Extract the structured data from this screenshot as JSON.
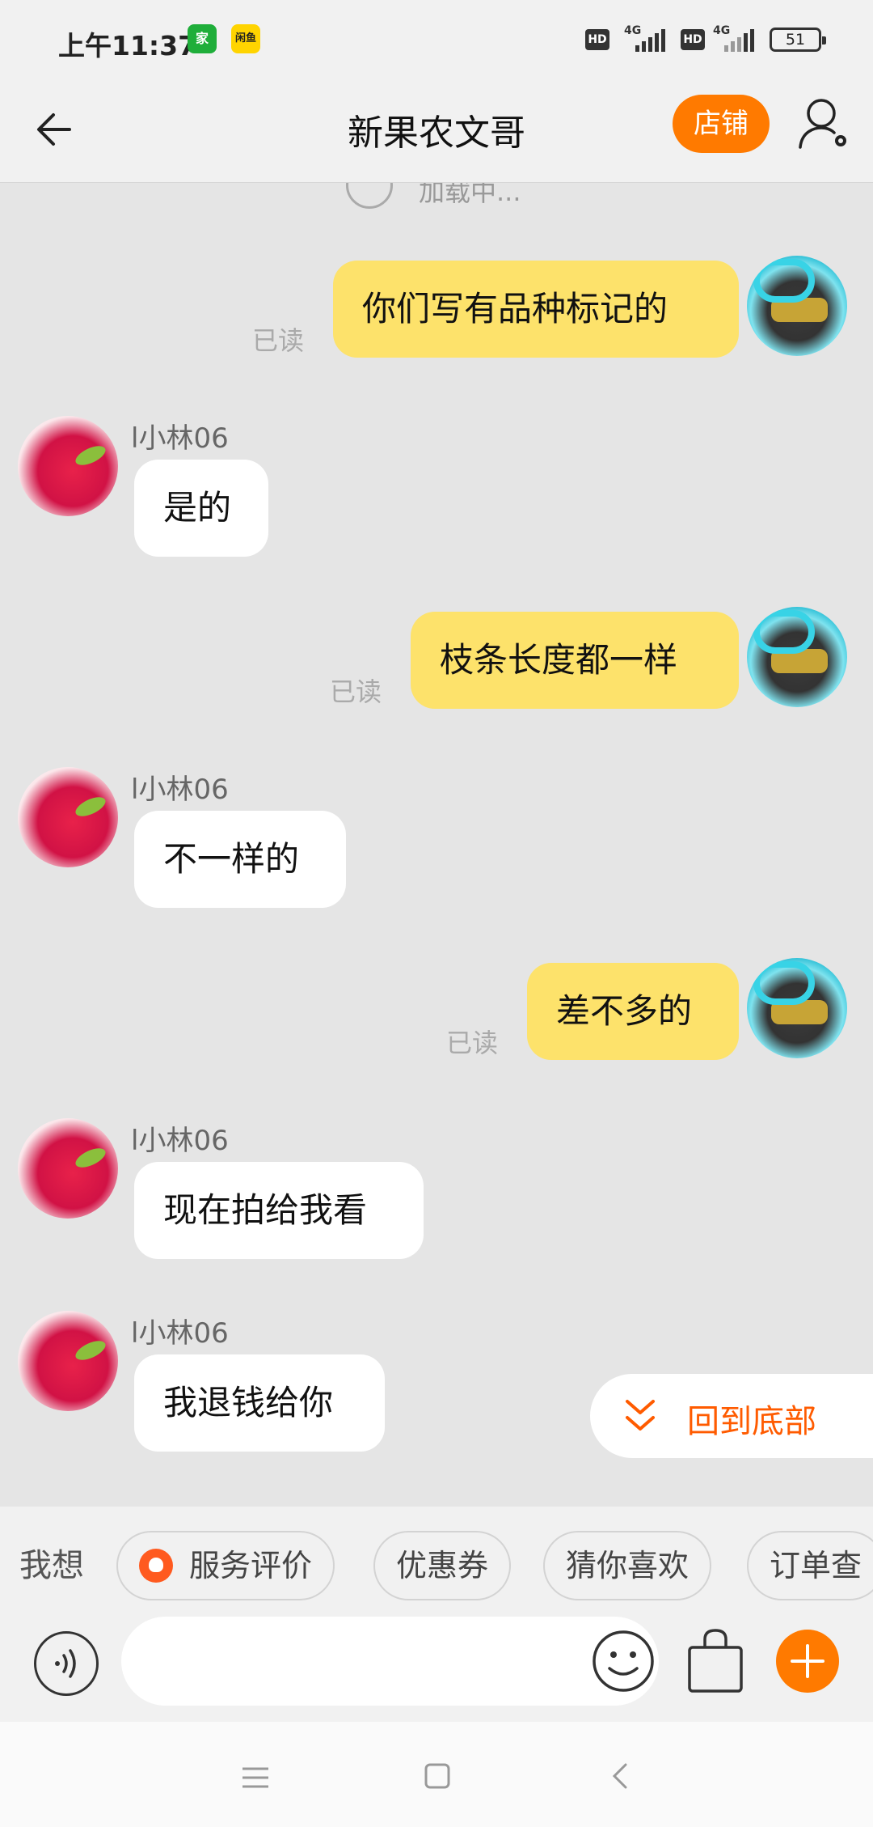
{
  "status_bar": {
    "time": "上午11:37",
    "app_badge_1": "家",
    "app_badge_2": "闲鱼",
    "hd_1": "HD",
    "hd_2": "HD",
    "net_1": "4G",
    "net_2": "4G",
    "battery": "51"
  },
  "header": {
    "title": "新果农文哥",
    "shop_button": "店铺"
  },
  "chat": {
    "loading_text": "加载中...",
    "read_label": "已读",
    "messages": [
      {
        "from": "me",
        "text": "你们写有品种标记的",
        "read": "已读"
      },
      {
        "from": "them",
        "name": "l小林06",
        "text": "是的"
      },
      {
        "from": "me",
        "text": "枝条长度都一样",
        "read": "已读"
      },
      {
        "from": "them",
        "name": "l小林06",
        "text": "不一样的"
      },
      {
        "from": "me",
        "text": "差不多的",
        "read": "已读"
      },
      {
        "from": "them",
        "name": "l小林06",
        "text": "现在拍给我看"
      },
      {
        "from": "them",
        "name": "l小林06",
        "text": "我退钱给你"
      }
    ],
    "back_to_bottom": "回到底部"
  },
  "quick_bar": {
    "label": "我想",
    "chips": [
      "服务评价",
      "优惠券",
      "猜你喜欢",
      "订单查"
    ]
  },
  "input_bar": {
    "placeholder": ""
  },
  "colors": {
    "accent": "#ff7a00",
    "my_bubble": "#fde26b",
    "their_bubble": "#ffffff",
    "chat_bg": "#e5e5e5"
  }
}
